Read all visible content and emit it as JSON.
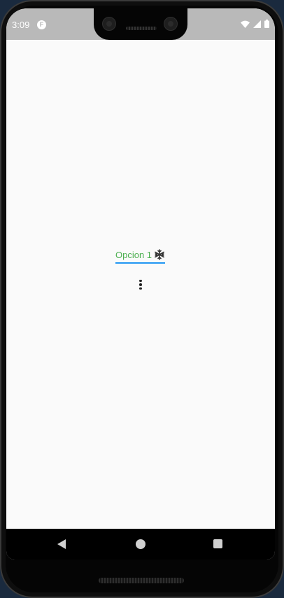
{
  "status_bar": {
    "time": "3:09",
    "app_icon_letter": "F",
    "icons": [
      "wifi-icon",
      "signal-icon",
      "battery-icon"
    ],
    "background_color": "#b9b9b9"
  },
  "main": {
    "dropdown": {
      "selected_label": "Opcion 1",
      "selected_icon": "snowflake-icon",
      "label_color": "#4caf50",
      "underline_color": "#2196f3"
    },
    "menu_button_icon": "more-vert-icon"
  },
  "nav_bar": {
    "buttons": [
      "back-icon",
      "home-icon",
      "recents-icon"
    ]
  }
}
